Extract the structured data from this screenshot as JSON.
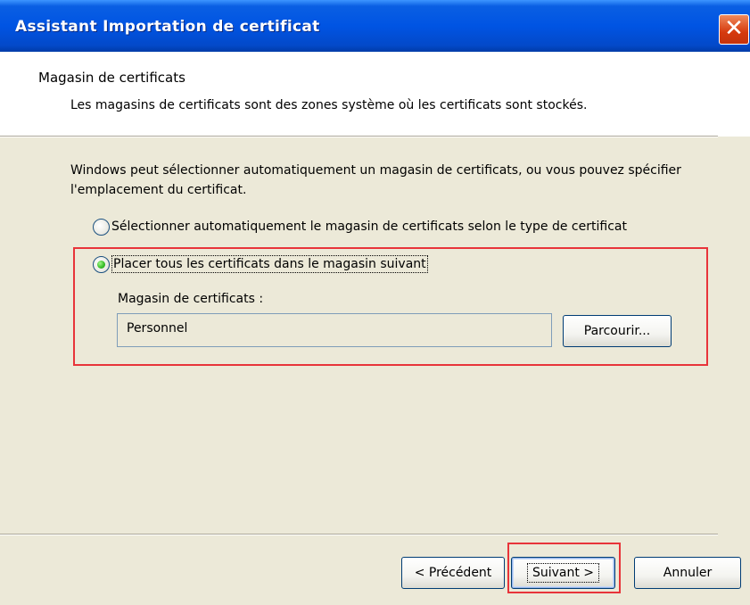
{
  "window": {
    "title": "Assistant Importation de certificat",
    "close_glyph": "✕"
  },
  "header": {
    "title": "Magasin de certificats",
    "description": "Les magasins de certificats sont des zones système où les certificats sont stockés."
  },
  "body": {
    "intro": "Windows peut sélectionner automatiquement un magasin de certificats, ou vous pouvez spécifier l'emplacement du certificat.",
    "radio_auto": {
      "label": "Sélectionner automatiquement le magasin de certificats selon le type de certificat",
      "checked": false
    },
    "radio_manual": {
      "label": "Placer tous les certificats dans le magasin suivant",
      "checked": true
    },
    "store_label": "Magasin de certificats :",
    "store_value": "Personnel",
    "browse_label": "Parcourir..."
  },
  "footer": {
    "back_label": "< Précédent",
    "next_label": "Suivant >",
    "cancel_label": "Annuler"
  },
  "colors": {
    "titlebar": "#0054e3",
    "dialog_bg": "#ece9d8",
    "highlight_box": "#e8343a",
    "radio_checked": "#3bc12a"
  }
}
